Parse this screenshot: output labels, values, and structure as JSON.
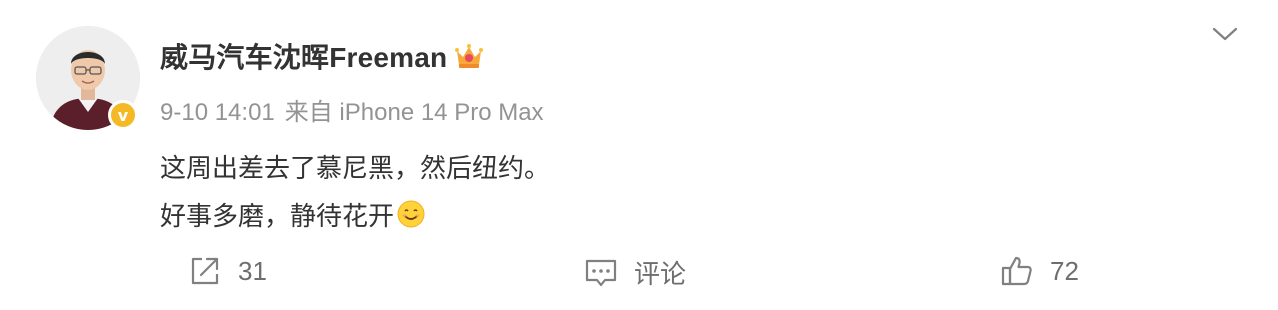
{
  "post": {
    "username": "威马汽车沈晖Freeman",
    "time": "9-10 14:01",
    "source": "来自 iPhone 14 Pro Max",
    "content_line1": "这周出差去了慕尼黑，然后纽约。",
    "content_line2": "好事多磨，静待花开"
  },
  "badges": {
    "verified_letter": "v",
    "verified_color": "#f5b926"
  },
  "actions": {
    "repost_count": "31",
    "comment_label": "评论",
    "like_count": "72"
  },
  "icons": {
    "crown": "crown-icon",
    "emoji": "smile-emoji-icon",
    "menu": "chevron-down-icon",
    "repost": "share-icon",
    "comment": "comment-icon",
    "like": "thumbs-up-icon"
  }
}
